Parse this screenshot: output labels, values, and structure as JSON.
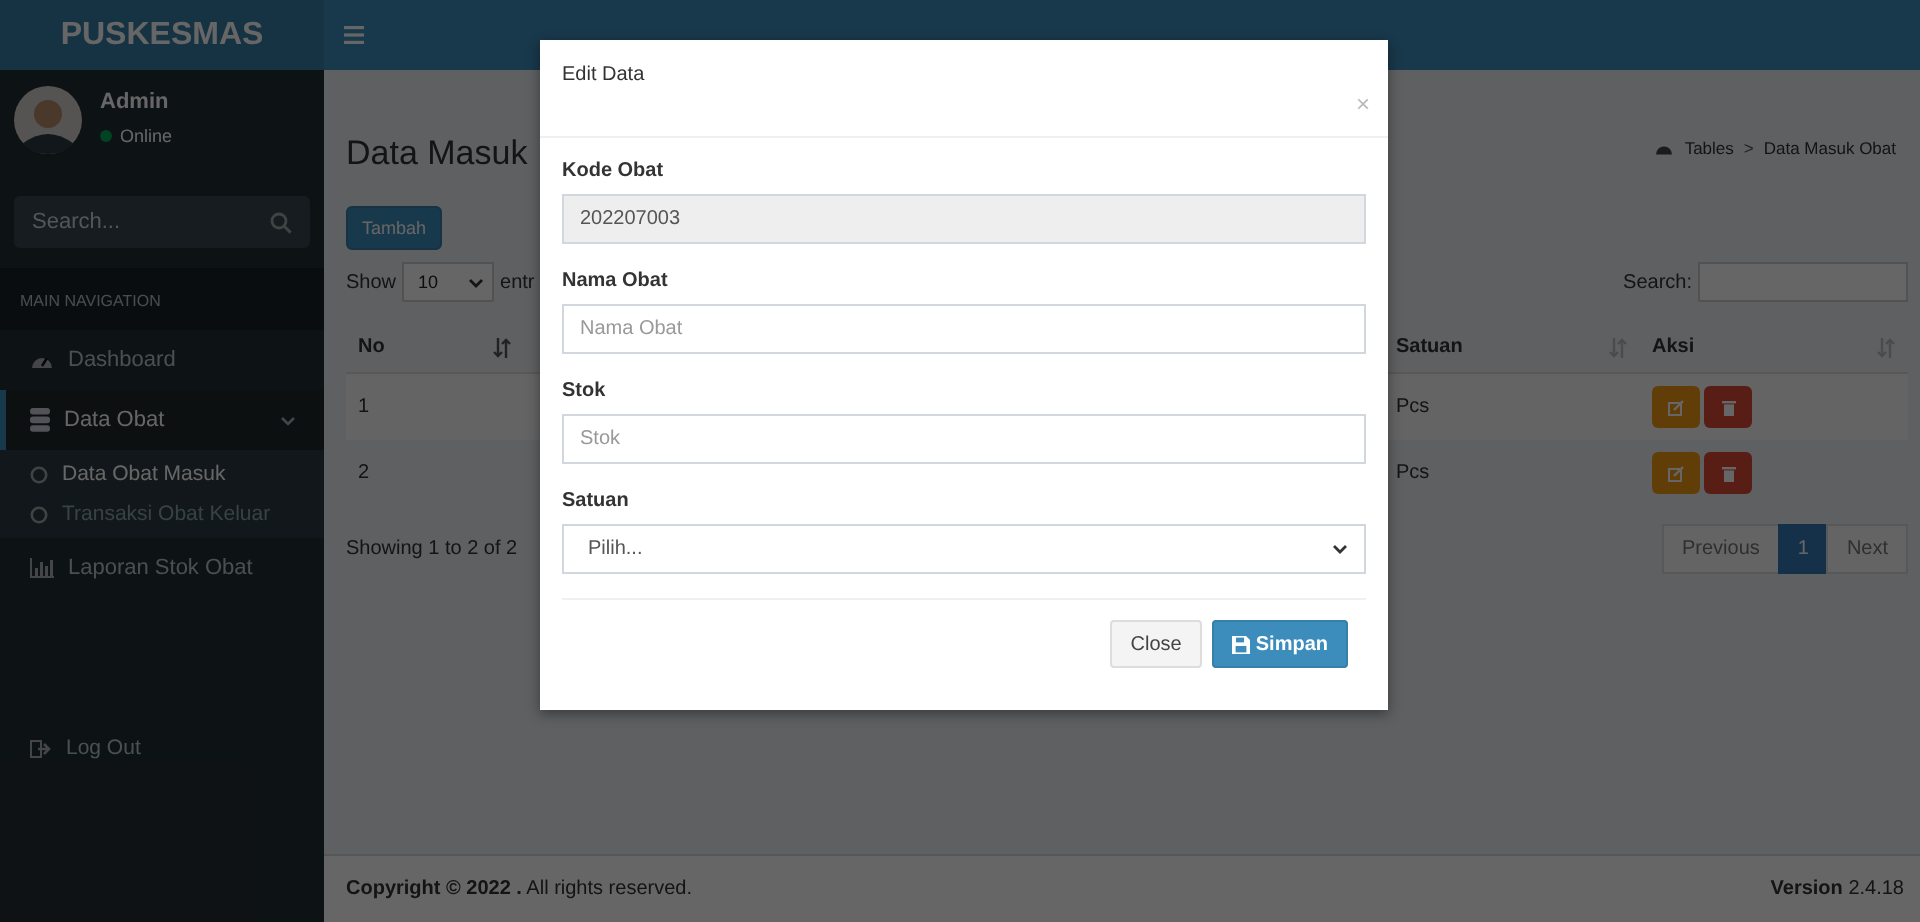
{
  "brand": "PUSKESMAS",
  "user": {
    "name": "Admin",
    "status": "Online"
  },
  "sidebar_search": {
    "placeholder": "Search..."
  },
  "nav_header": "MAIN NAVIGATION",
  "nav": [
    {
      "label": "Dashboard",
      "kind": "link",
      "selected": false
    },
    {
      "label": "Data Obat",
      "kind": "tree",
      "selected": true,
      "expanded": true,
      "children": [
        {
          "label": "Data Obat Masuk",
          "selected": true
        },
        {
          "label": "Transaksi Obat Keluar",
          "selected": false
        }
      ]
    },
    {
      "label": "Laporan Stok Obat",
      "kind": "link",
      "selected": false
    }
  ],
  "logout": "Log Out",
  "page": {
    "title": "Data Masuk",
    "breadcrumb": [
      "Tables",
      "Data Masuk Obat"
    ],
    "breadcrumb_separator": ">",
    "add_button": "Tambah",
    "length": {
      "prefix": "Show",
      "value": "10",
      "suffix": "entr"
    },
    "search_label": "Search:",
    "columns": [
      "No",
      "Satuan",
      "Aksi"
    ],
    "rows": [
      {
        "cells": [
          "1",
          "Pcs"
        ]
      },
      {
        "cells": [
          "2",
          "Pcs"
        ]
      }
    ],
    "info": "Showing 1 to 2 of 2",
    "pagination": [
      {
        "label": "Previous",
        "selected": false
      },
      {
        "label": "1",
        "selected": true
      },
      {
        "label": "Next",
        "selected": false
      }
    ]
  },
  "footer": {
    "copyright": "**Copyright © 2022 .** All rights reserved.",
    "version_label": "Version",
    "version": "2.4.18"
  },
  "modal": {
    "title": "Edit Data",
    "close": "×",
    "fields": [
      {
        "label": "Kode Obat",
        "kind": "text",
        "value": "202207003",
        "disabled": true
      },
      {
        "label": "Nama Obat",
        "kind": "text",
        "placeholder": "Nama Obat",
        "disabled": false
      },
      {
        "label": "Stok",
        "kind": "text",
        "placeholder": "Stok",
        "disabled": false
      },
      {
        "label": "Satuan",
        "kind": "select",
        "value": "Pilih...",
        "disabled": false
      }
    ],
    "buttons": [
      {
        "label": "Close",
        "kind": "default"
      },
      {
        "label": "Simpan",
        "kind": "primary"
      }
    ]
  }
}
